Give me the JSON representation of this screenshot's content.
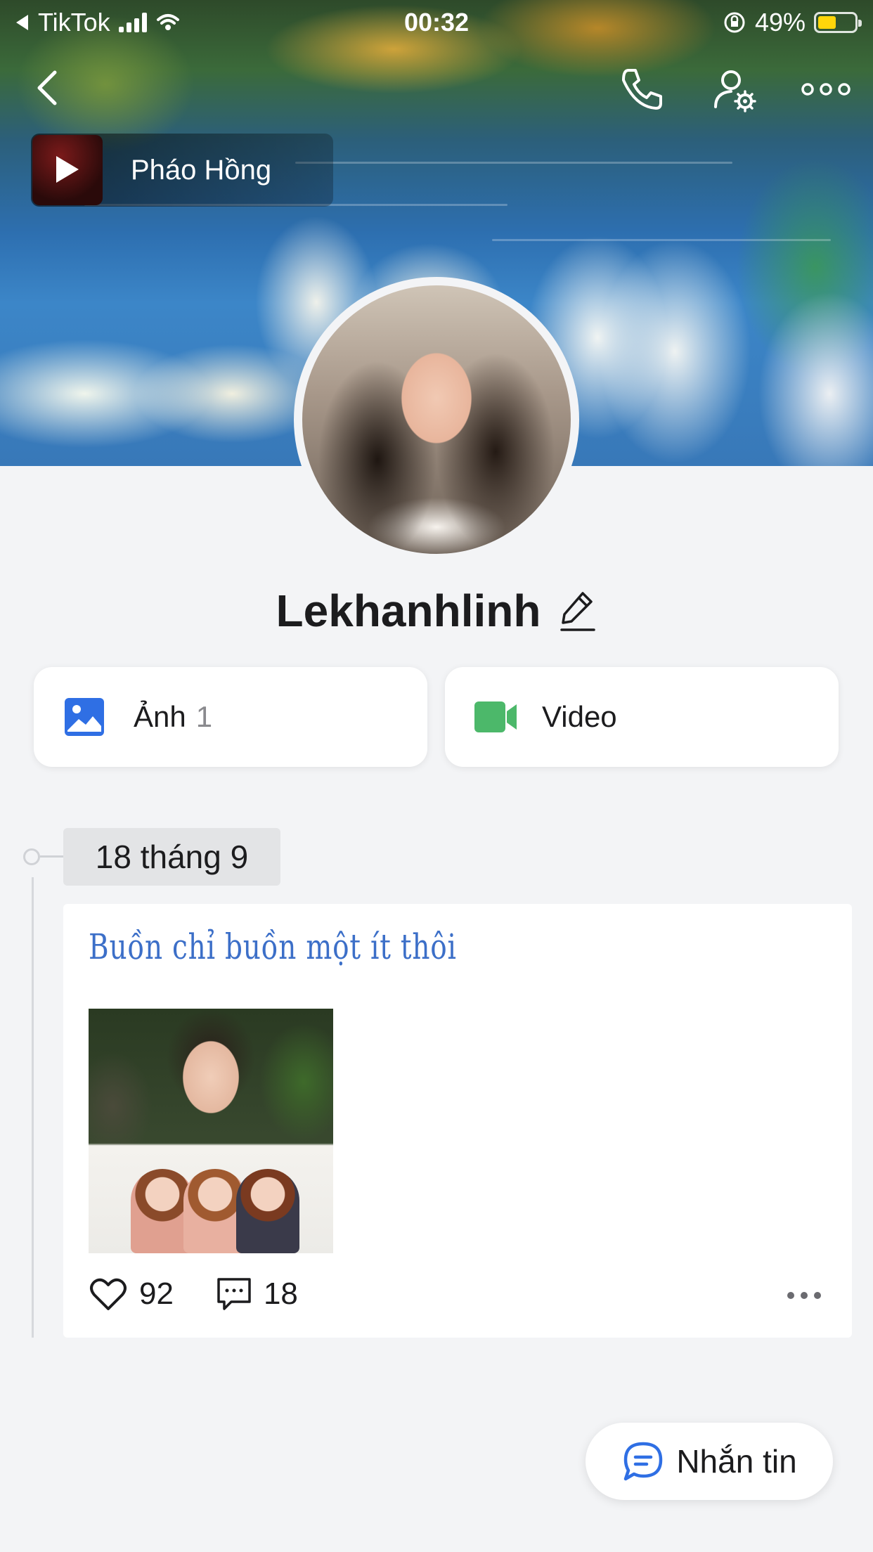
{
  "status_bar": {
    "back_app": "TikTok",
    "time": "00:32",
    "battery": "49%",
    "battery_level": 0.49
  },
  "cover": {
    "music_title": "Pháo Hồng"
  },
  "profile": {
    "name": "Lekhanhlinh"
  },
  "media": {
    "photos_label": "Ảnh",
    "photos_count": "1",
    "video_label": "Video"
  },
  "timeline": {
    "date": "18 tháng 9",
    "post": {
      "text": "Buồn chỉ buồn một ít thôi",
      "likes": "92",
      "comments": "18"
    }
  },
  "message_button": {
    "label": "Nhắn tin"
  },
  "colors": {
    "accent_blue": "#3c6fc8",
    "photo_icon_blue": "#2f6fe4",
    "video_icon_green": "#4cb86a",
    "page_bg": "#f3f4f6"
  }
}
